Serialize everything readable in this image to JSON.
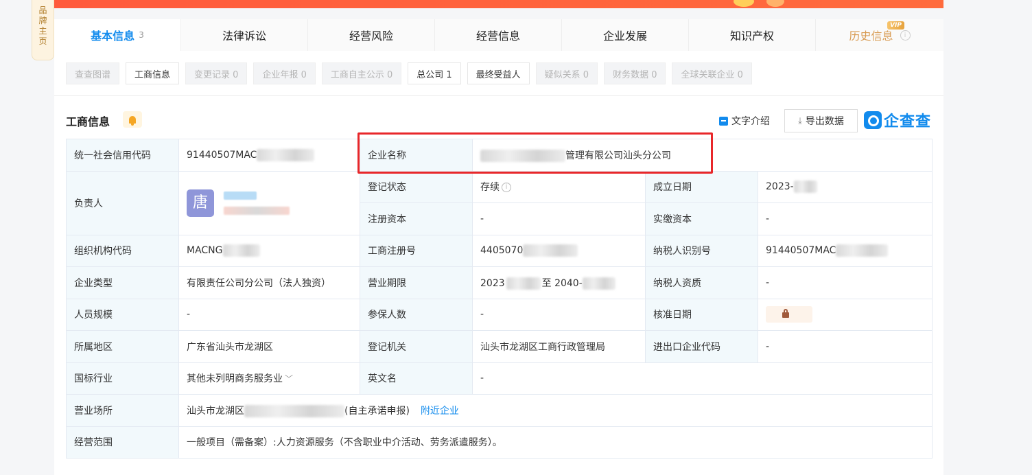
{
  "side_tab": {
    "chars": [
      "品",
      "牌",
      "主",
      "页"
    ]
  },
  "tabs": [
    {
      "label": "基本信息",
      "count": "3"
    },
    {
      "label": "法律诉讼"
    },
    {
      "label": "经营风险"
    },
    {
      "label": "经营信息"
    },
    {
      "label": "企业发展"
    },
    {
      "label": "知识产权"
    },
    {
      "label": "历史信息",
      "badge": "VIP"
    }
  ],
  "subtabs": [
    {
      "label": "查查图谱",
      "active": false
    },
    {
      "label": "工商信息",
      "active": true
    },
    {
      "label": "变更记录 0",
      "active": false
    },
    {
      "label": "企业年报 0",
      "active": false
    },
    {
      "label": "工商自主公示 0",
      "active": false
    },
    {
      "label": "总公司 1",
      "active": true
    },
    {
      "label": "最终受益人",
      "active": true
    },
    {
      "label": "疑似关系 0",
      "active": false
    },
    {
      "label": "财务数据 0",
      "active": false
    },
    {
      "label": "全球关联企业 0",
      "active": false
    }
  ],
  "section": {
    "title": "工商信息",
    "text_intro": "文字介绍",
    "export": "导出数据",
    "brand": "企查查"
  },
  "icons": {
    "bell": "bell-icon",
    "doc": "document-icon",
    "download": "download-icon",
    "lock": "lock-icon",
    "info": "info-icon"
  },
  "info": {
    "credit_code_label": "统一社会信用代码",
    "credit_code_value": "91440507MAC",
    "company_name_label": "企业名称",
    "company_name_value": "管理有限公司汕头分公司",
    "leader_label": "负责人",
    "leader_avatar": "唐",
    "reg_status_label": "登记状态",
    "reg_status_value": "存续",
    "found_date_label": "成立日期",
    "found_date_value": "2023-",
    "reg_capital_label": "注册资本",
    "reg_capital_value": "-",
    "paid_capital_label": "实缴资本",
    "paid_capital_value": "-",
    "org_code_label": "组织机构代码",
    "org_code_value": "MACNG",
    "biz_reg_no_label": "工商注册号",
    "biz_reg_no_value": "4405070",
    "taxpayer_id_label": "纳税人识别号",
    "taxpayer_id_value": "91440507MAC",
    "company_type_label": "企业类型",
    "company_type_value": "有限责任公司分公司（法人独资）",
    "biz_term_label": "营业期限",
    "biz_term_start": "2023",
    "biz_term_mid": "至 2040-",
    "taxpayer_qual_label": "纳税人资质",
    "taxpayer_qual_value": "-",
    "staff_size_label": "人员规模",
    "staff_size_value": "-",
    "insured_label": "参保人数",
    "insured_value": "-",
    "approve_date_label": "核准日期",
    "region_label": "所属地区",
    "region_value": "广东省汕头市龙湖区",
    "reg_authority_label": "登记机关",
    "reg_authority_value": "汕头市龙湖区工商行政管理局",
    "import_export_label": "进出口企业代码",
    "import_export_value": "-",
    "industry_label": "国标行业",
    "industry_value": "其他未列明商务服务业",
    "english_name_label": "英文名",
    "english_name_value": "-",
    "address_label": "营业场所",
    "address_value": "汕头市龙湖区",
    "address_suffix": "(自主承诺申报)",
    "nearby_link": "附近企业",
    "scope_label": "经营范围",
    "scope_value": "一般项目（需备案）:人力资源服务（不含职业中介活动、劳务派遣服务）。"
  }
}
